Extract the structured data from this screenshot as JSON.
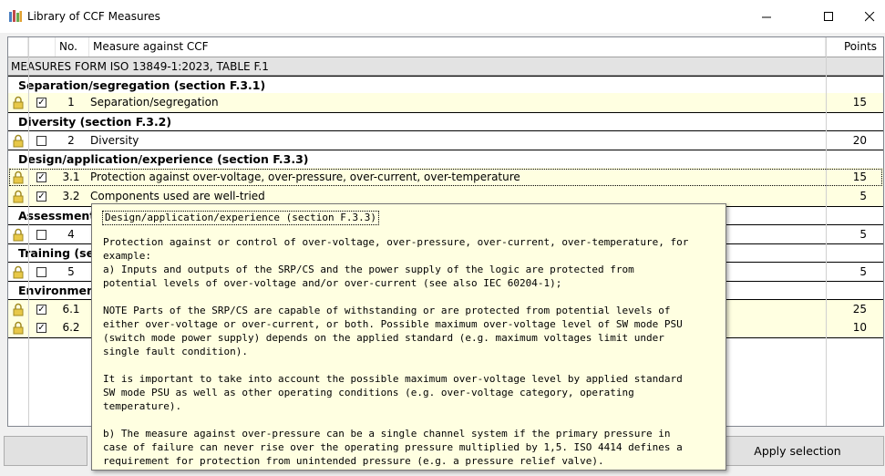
{
  "window": {
    "title": "Library of CCF Measures",
    "icon": "library-app-icon"
  },
  "columns": {
    "no": "No.",
    "measure": "Measure against CCF",
    "points": "Points"
  },
  "group_title": "MEASURES FORM ISO 13849-1:2023, TABLE F.1",
  "sections": [
    {
      "title": "Separation/segregation (section F.3.1)"
    },
    {
      "title": "Diversity (section F.3.2)"
    },
    {
      "title": "Design/application/experience (section F.3.3)"
    },
    {
      "title": "Assessment/"
    },
    {
      "title": "Training (se"
    },
    {
      "title": "Environment"
    }
  ],
  "items": [
    {
      "no": "1",
      "label": "Separation/segregation",
      "points": "15",
      "checked": true,
      "check": "✓"
    },
    {
      "no": "2",
      "label": "Diversity",
      "points": "20",
      "checked": false,
      "check": ""
    },
    {
      "no": "3.1",
      "label": "Protection against over-voltage, over-pressure, over-current, over-temperature",
      "points": "15",
      "checked": true,
      "check": "✓"
    },
    {
      "no": "3.2",
      "label": "Components used are well-tried",
      "points": "5",
      "checked": true,
      "check": "✓"
    },
    {
      "no": "4",
      "label": "",
      "points": "5",
      "checked": false,
      "check": ""
    },
    {
      "no": "5",
      "label": "",
      "points": "5",
      "checked": false,
      "check": ""
    },
    {
      "no": "6.1",
      "label": "",
      "points": "25",
      "checked": true,
      "check": "✓"
    },
    {
      "no": "6.2",
      "label": "",
      "points": "10",
      "checked": true,
      "check": "✓"
    }
  ],
  "buttons": {
    "apply": "Apply selection"
  },
  "tooltip": {
    "title": "Design/application/experience (section F.3.3)",
    "lines": [
      "Protection against or control of over-voltage, over-pressure, over-current, over-temperature, for",
      "example:",
      "a) Inputs and outputs of the SRP/CS and the power supply of the logic are protected from",
      "potential levels of over-voltage and/or over-current (see also IEC 60204-1);",
      "NOTE Parts of the SRP/CS are capable of withstanding or are protected from potential levels of",
      "either over-voltage or over-current, or both. Possible maximum over-voltage level of SW mode PSU",
      "(switch mode power supply) depends on the applied standard (e.g. maximum voltages limit under",
      "single fault condition).",
      "It is important to take into account the possible maximum over-voltage level by applied standard",
      "SW mode PSU as well as other operating conditions (e.g. over-voltage category, operating",
      "temperature).",
      "b) The measure against over-pressure can be a single channel system if the primary pressure in",
      "case of failure can never rise over the operating pressure multiplied by 1,5. ISO 4414 defines a",
      "requirement for protection from unintended pressure (e.g. a pressure relief valve)."
    ]
  }
}
